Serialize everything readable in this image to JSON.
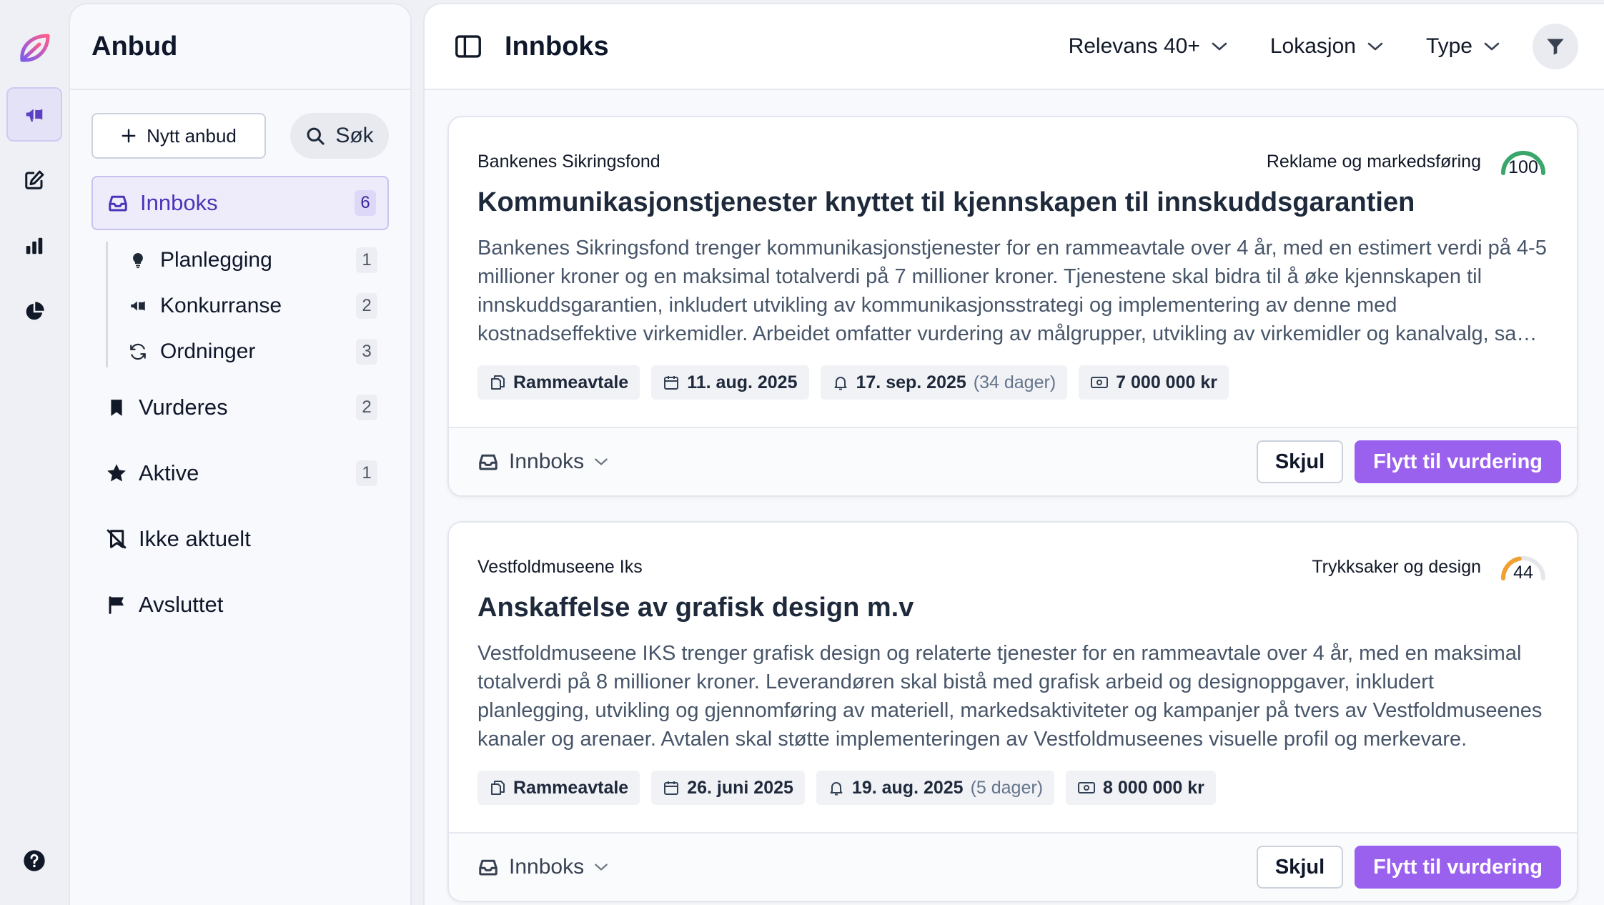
{
  "panel": {
    "title": "Anbud",
    "new_button": "Nytt anbud",
    "search_button": "Søk",
    "nav": {
      "inbox": {
        "label": "Innboks",
        "count": "6"
      },
      "sub": [
        {
          "label": "Planlegging",
          "count": "1",
          "icon": "lightbulb-icon"
        },
        {
          "label": "Konkurranse",
          "count": "2",
          "icon": "megaphone-icon"
        },
        {
          "label": "Ordninger",
          "count": "3",
          "icon": "refresh-icon"
        }
      ],
      "assess": {
        "label": "Vurderes",
        "count": "2"
      },
      "active": {
        "label": "Aktive",
        "count": "1"
      },
      "irrelevant": {
        "label": "Ikke aktuelt"
      },
      "finished": {
        "label": "Avsluttet"
      }
    }
  },
  "main": {
    "title": "Innboks",
    "filters": {
      "relevance": "Relevans 40+",
      "location": "Lokasjon",
      "type": "Type"
    }
  },
  "cards": [
    {
      "buyer": "Bankenes Sikringsfond",
      "category": "Reklame og markedsføring",
      "score": "100",
      "score_fraction": 1.0,
      "score_color": "#3aa66a",
      "title": "Kommunikasjonstjenester knyttet til kjennskapen til innskuddsgarantien",
      "description": "Bankenes Sikringsfond trenger kommunikasjonstjenester for en rammeavtale over 4 år, med en estimert verdi på 4-5 millioner kroner og en maksimal totalverdi på 7 millioner kroner. Tjenestene skal bidra til å øke kjennskapen til innskuddsgarantien, inkludert utvikling av kommunikasjonsstrategi og implementering av denne med kostnadseffektive virkemidler. Arbeidet omfatter vurdering av målgrupper, utvikling av virkemidler og kanalvalg, samt gjennomføring og evaluering av tiltak.",
      "contract_type": "Rammeavtale",
      "published": "11. aug. 2025",
      "deadline": "17. sep. 2025",
      "days_left": "(34 dager)",
      "value": "7 000 000 kr",
      "status": "Innboks",
      "hide_label": "Skjul",
      "move_label": "Flytt til vurdering"
    },
    {
      "buyer": "Vestfoldmuseene Iks",
      "category": "Trykksaker og design",
      "score": "44",
      "score_fraction": 0.44,
      "score_color": "#f0a030",
      "title": "Anskaffelse av grafisk design m.v",
      "description": "Vestfoldmuseene IKS trenger grafisk design og relaterte tjenester for en rammeavtale over 4 år, med en maksimal totalverdi på 8 millioner kroner. Leverandøren skal bistå med grafisk arbeid og designoppgaver, inkludert planlegging, utvikling og gjennomføring av materiell, markedsaktiviteter og kampanjer på tvers av Vestfoldmuseenes kanaler og arenaer. Avtalen skal støtte implementeringen av Vestfoldmuseenes visuelle profil og merkevare.",
      "contract_type": "Rammeavtale",
      "published": "26. juni 2025",
      "deadline": "19. aug. 2025",
      "days_left": "(5 dager)",
      "value": "8 000 000 kr",
      "status": "Innboks",
      "hide_label": "Skjul",
      "move_label": "Flytt til vurdering"
    }
  ]
}
